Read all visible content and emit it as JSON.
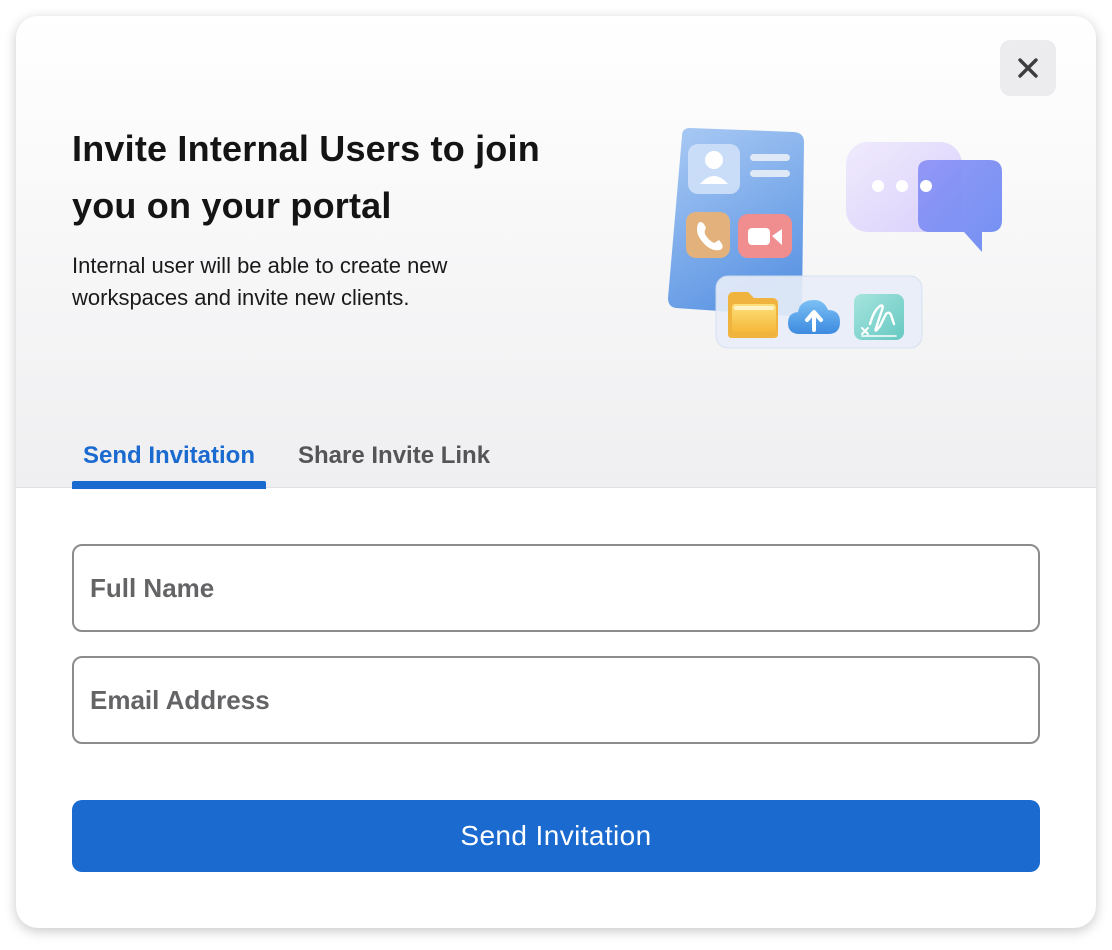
{
  "dialog": {
    "close_icon": "close-icon",
    "title": "Invite Internal Users to join you on your portal",
    "subtitle": "Internal user will be able to create new workspaces and invite new clients."
  },
  "illustration": {
    "icons": [
      "contact-icon",
      "list-icon",
      "phone-icon",
      "video-icon",
      "chat-bubble-icon",
      "folder-icon",
      "cloud-upload-icon",
      "signature-icon"
    ]
  },
  "tabs": [
    {
      "label": "Send Invitation",
      "active": true
    },
    {
      "label": "Share Invite Link",
      "active": false
    }
  ],
  "form": {
    "full_name": {
      "placeholder": "Full Name",
      "value": ""
    },
    "email": {
      "placeholder": "Email Address",
      "value": ""
    },
    "submit_label": "Send Invitation"
  },
  "colors": {
    "accent": "#1a6acf",
    "text_primary": "#141414",
    "tab_inactive": "#555558",
    "border": "#8c8c8e"
  }
}
